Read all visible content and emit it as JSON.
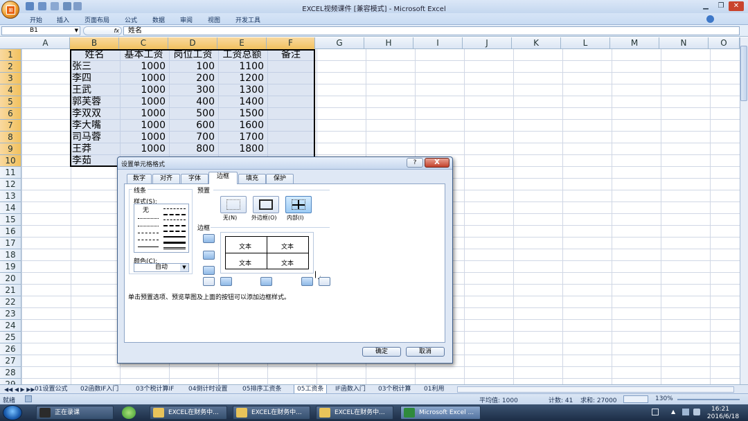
{
  "window": {
    "title": "EXCEL视频课件 [兼容模式] - Microsoft Excel"
  },
  "ribbon_tabs": [
    "开始",
    "插入",
    "页面布局",
    "公式",
    "数据",
    "审阅",
    "视图",
    "开发工具"
  ],
  "formula_bar": {
    "name_box": "B1",
    "fx": "fx",
    "content": "姓名"
  },
  "columns": [
    "A",
    "B",
    "C",
    "D",
    "E",
    "F",
    "G",
    "H",
    "I",
    "J",
    "K",
    "L",
    "M",
    "N",
    "O"
  ],
  "rows": [
    "1",
    "2",
    "3",
    "4",
    "5",
    "6",
    "7",
    "8",
    "9",
    "10",
    "11",
    "12",
    "13",
    "14",
    "15",
    "16",
    "17",
    "18",
    "19",
    "20",
    "21",
    "22",
    "23",
    "24",
    "25",
    "26",
    "27",
    "28",
    "29"
  ],
  "table": {
    "headers": [
      "姓名",
      "基本工资",
      "岗位工资",
      "工资总额",
      "备注"
    ],
    "rows": [
      {
        "name": "张三",
        "base": "1000",
        "post": "100",
        "total": "1100"
      },
      {
        "name": "李四",
        "base": "1000",
        "post": "200",
        "total": "1200"
      },
      {
        "name": "王武",
        "base": "1000",
        "post": "300",
        "total": "1300"
      },
      {
        "name": "郭芙蓉",
        "base": "1000",
        "post": "400",
        "total": "1400"
      },
      {
        "name": "李双双",
        "base": "1000",
        "post": "500",
        "total": "1500"
      },
      {
        "name": "李大嘴",
        "base": "1000",
        "post": "600",
        "total": "1600"
      },
      {
        "name": "司马蓉",
        "base": "1000",
        "post": "700",
        "total": "1700"
      },
      {
        "name": "王莽",
        "base": "1000",
        "post": "800",
        "total": "1800"
      },
      {
        "name": "李茹",
        "base": "",
        "post": "",
        "total": ""
      }
    ]
  },
  "sheet_tabs": [
    "01设置公式",
    "02函数IF入门",
    "03个税计算IF",
    "04倒计时设置",
    "05排序工资条",
    "05工资条",
    "IF函数入门",
    "03个税计算",
    "01利用"
  ],
  "status": {
    "mode": "就绪",
    "average": "平均值: 1000",
    "count": "计数: 41",
    "sum": "求和: 27000",
    "zoom": "130%"
  },
  "dialog": {
    "title": "设置单元格格式",
    "help": "?",
    "close": "X",
    "tabs": [
      "数字",
      "对齐",
      "字体",
      "边框",
      "填充",
      "保护"
    ],
    "active_tab": "边框",
    "line_group": "线条",
    "style_label": "样式(S):",
    "style_none": "无",
    "color_label": "颜色(C):",
    "color_value": "自动",
    "preset_group": "预置",
    "presets": [
      "无(N)",
      "外边框(O)",
      "内部(I)"
    ],
    "border_group": "边框",
    "preview_text": "文本",
    "hint": "单击预置选项、预览草图及上面的按钮可以添加边框样式。",
    "ok": "确定",
    "cancel": "取消"
  },
  "taskbar": {
    "items": [
      "正在录课",
      "EXCEL在财务中...",
      "EXCEL在财务中...",
      "EXCEL在财务中...",
      "Microsoft Excel ..."
    ],
    "time": "16:21",
    "date": "2016/6/18"
  }
}
